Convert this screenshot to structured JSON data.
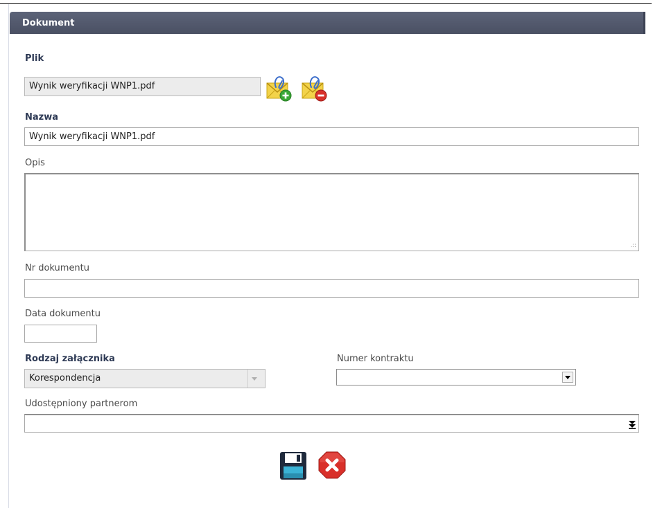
{
  "panel": {
    "title": "Dokument"
  },
  "plik": {
    "label": "Plik",
    "value": "Wynik weryfikacji WNP1.pdf",
    "icons": {
      "add": "attach-add-icon",
      "remove": "attach-remove-icon"
    }
  },
  "nazwa": {
    "label": "Nazwa",
    "value": "Wynik weryfikacji WNP1.pdf"
  },
  "opis": {
    "label": "Opis",
    "value": ""
  },
  "nr_dokumentu": {
    "label": "Nr dokumentu",
    "value": ""
  },
  "data_dokumentu": {
    "label": "Data dokumentu",
    "value": ""
  },
  "rodzaj": {
    "label": "Rodzaj załącznika",
    "selected": "Korespondencja"
  },
  "numer_kontraktu": {
    "label": "Numer kontraktu",
    "selected": ""
  },
  "udostepniony": {
    "label": "Udostępniony partnerom",
    "selected": ""
  },
  "actions": {
    "save_icon": "floppy-disk-icon",
    "cancel_icon": "red-x-icon"
  },
  "colors": {
    "header_bg": "#50566a",
    "label_bold": "#2e3a55",
    "cancel_red": "#d9302a"
  }
}
